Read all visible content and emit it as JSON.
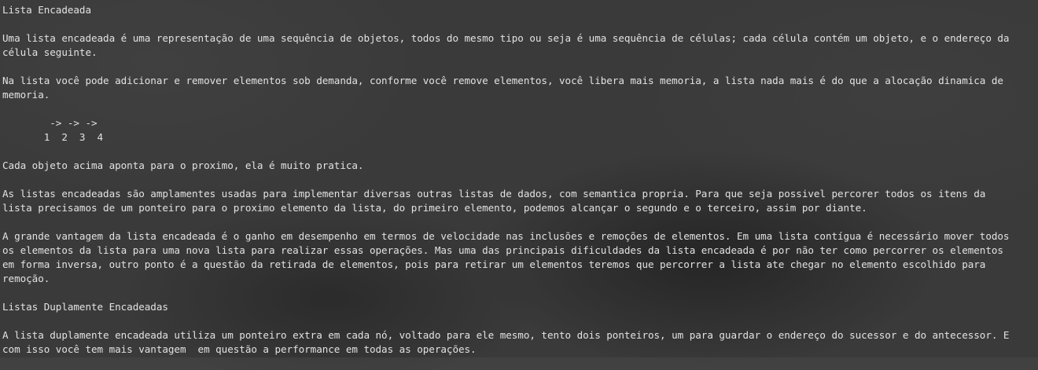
{
  "document": {
    "heading_lista": "Lista Encadeada",
    "p1": [
      "Uma lista encadeada é uma representação de uma sequência de objetos, todos do mesmo tipo ou seja é uma sequência de células; cada célula contém um objeto, e o endereço da",
      "célula seguinte."
    ],
    "p2": [
      "Na lista você pode adicionar e remover elementos sob demanda, conforme você remove elementos, você libera mais memoria, a lista nada mais é do que a alocação dinamica de",
      "memoria."
    ],
    "diagram": {
      "arrows": "        -> -> ->",
      "nodes": "       1  2  3  4"
    },
    "p3": "Cada objeto acima aponta para o proximo, ela é muito pratica.",
    "p4": [
      "As listas encadeadas são amplamentes usadas para implementar diversas outras listas de dados, com semantica propria. Para que seja possivel percorer todos os itens da",
      "lista precisamos de um ponteiro para o proximo elemento da lista, do primeiro elemento, podemos alcançar o segundo e o terceiro, assim por diante."
    ],
    "p5": [
      "A grande vantagem da lista encadeada é o ganho em desempenho em termos de velocidade nas inclusões e remoções de elementos. Em uma lista contígua é necessário mover todos",
      "os elementos da lista para uma nova lista para realizar essas operações. Mas uma das principais dificuldades da lista encadeada é por não ter como percorrer os elementos",
      "em forma inversa, outro ponto é a questão da retirada de elementos, pois para retirar um elementos teremos que percorrer a lista ate chegar no elemento escolhido para",
      "remoção."
    ],
    "heading_duplamente": "Listas Duplamente Encadeadas",
    "p6": [
      "A lista duplamente encadeada utiliza um ponteiro extra em cada nó, voltado para ele mesmo, tento dois ponteiros, um para guardar o endereço do sucessor e do antecessor. E",
      "com isso você tem mais vantagem  em questão a performance em todas as operações."
    ]
  }
}
